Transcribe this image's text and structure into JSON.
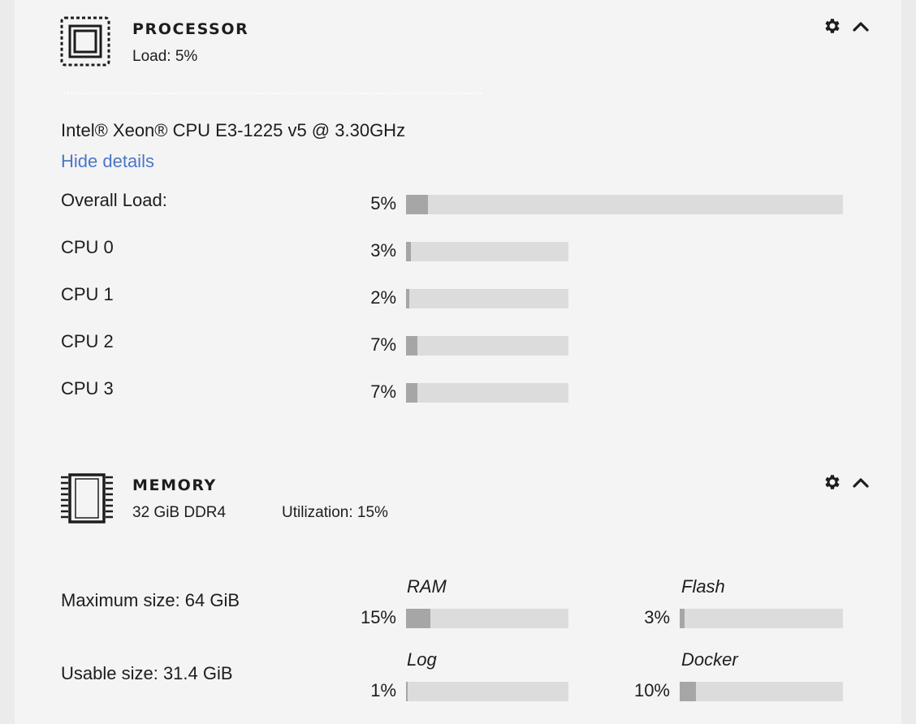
{
  "processor": {
    "title": "PROCESSOR",
    "load_text": "Load: 5%",
    "model": "Intel® Xeon® CPU E3-1225 v5 @ 3.30GHz",
    "toggle_details": "Hide details",
    "overall": {
      "label": "Overall Load:",
      "pct_text": "5%",
      "value": 5
    },
    "cores": [
      {
        "label": "CPU 0",
        "pct_text": "3%",
        "value": 3
      },
      {
        "label": "CPU 1",
        "pct_text": "2%",
        "value": 2
      },
      {
        "label": "CPU 2",
        "pct_text": "7%",
        "value": 7
      },
      {
        "label": "CPU 3",
        "pct_text": "7%",
        "value": 7
      }
    ],
    "icons": {
      "settings": "gear-icon",
      "collapse": "chevron-up-icon",
      "main": "cpu-chip-icon"
    }
  },
  "memory": {
    "title": "MEMORY",
    "size_text": "32 GiB DDR4",
    "utilization_text": "Utilization: 15%",
    "max_size": "Maximum size: 64 GiB",
    "usable_size": "Usable size: 31.4 GiB",
    "bars": [
      {
        "caption": "RAM",
        "pct_text": "15%",
        "value": 15
      },
      {
        "caption": "Flash",
        "pct_text": "3%",
        "value": 3
      },
      {
        "caption": "Log",
        "pct_text": "1%",
        "value": 1
      },
      {
        "caption": "Docker",
        "pct_text": "10%",
        "value": 10
      }
    ],
    "icons": {
      "settings": "gear-icon",
      "collapse": "chevron-up-icon",
      "main": "memory-chip-icon"
    }
  },
  "colors": {
    "background": "#ebebeb",
    "panel": "#f4f4f4",
    "bar_track": "#dcdcdc",
    "bar_fill": "#a6a6a6",
    "link": "#4a76c9",
    "text": "#1d1d1d"
  }
}
